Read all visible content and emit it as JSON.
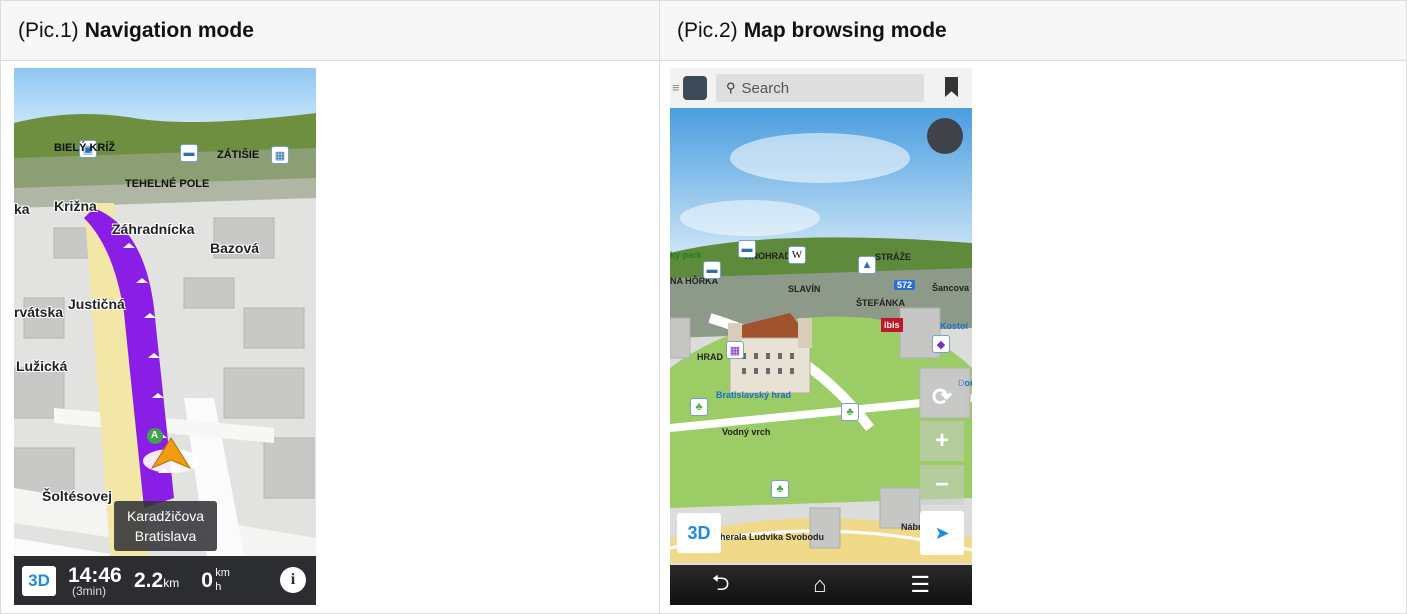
{
  "left": {
    "pic_label": "(Pic.1)",
    "title": "Navigation mode",
    "streets": {
      "biely_kriz": "BIELÝ KRÍŽ",
      "zatisie": "ZÁTIŠIE",
      "tehelne_pole": "TEHELNÉ POLE",
      "krizna": "Križna",
      "krizna_prefix": "ka",
      "zahradnicka": "Záhradnícka",
      "bazova": "Bazová",
      "vatska": "rvátska",
      "justicna": "Justičná",
      "luzicka": "Lužická",
      "soltesovej": "Šoltésovej"
    },
    "current_street": "Karadžičova",
    "current_city": "Bratislava",
    "waypoint": "A",
    "bar": {
      "mode_3d": "3D",
      "time": "14:46",
      "duration": "(3min)",
      "distance": "2.2",
      "distance_unit": "km",
      "speed": "0",
      "speed_unit_top": "km",
      "speed_unit_bottom": "h",
      "info": "i"
    }
  },
  "right": {
    "pic_label": "(Pic.2)",
    "title": "Map browsing mode",
    "search_placeholder": "Search",
    "labels": {
      "park": "ky park",
      "vinohrady": "VINOHRADY",
      "straze": "STRÁŽE",
      "na_horka": "NA HÔRKA",
      "slavin": "SLAVÍN",
      "route_572": "572",
      "sancova": "Šancova",
      "stefanka": "ŠTEFÁNKA",
      "ibis": "ibis",
      "kostol": "Kostol",
      "hrad": "HRAD",
      "bratislavsky_hrad": "Bratislavský hrad",
      "vodny_vrch": "Vodný vrch",
      "dor": "Dor",
      "nabr": "Nábr",
      "ludvika": "herala Ludvika Svobodu"
    },
    "controls": {
      "mode_3d": "3D",
      "zoom_in": "+",
      "zoom_out": "−",
      "rotate": "⟳",
      "locate": "➤"
    },
    "android": {
      "back": "⮌",
      "home": "⌂",
      "menu": "☰"
    }
  },
  "colors": {
    "route_purple": "#8a1ee6",
    "accent_blue": "#1f8be0",
    "nav_bar": "#2c2d30",
    "grass": "#9ccc65"
  }
}
